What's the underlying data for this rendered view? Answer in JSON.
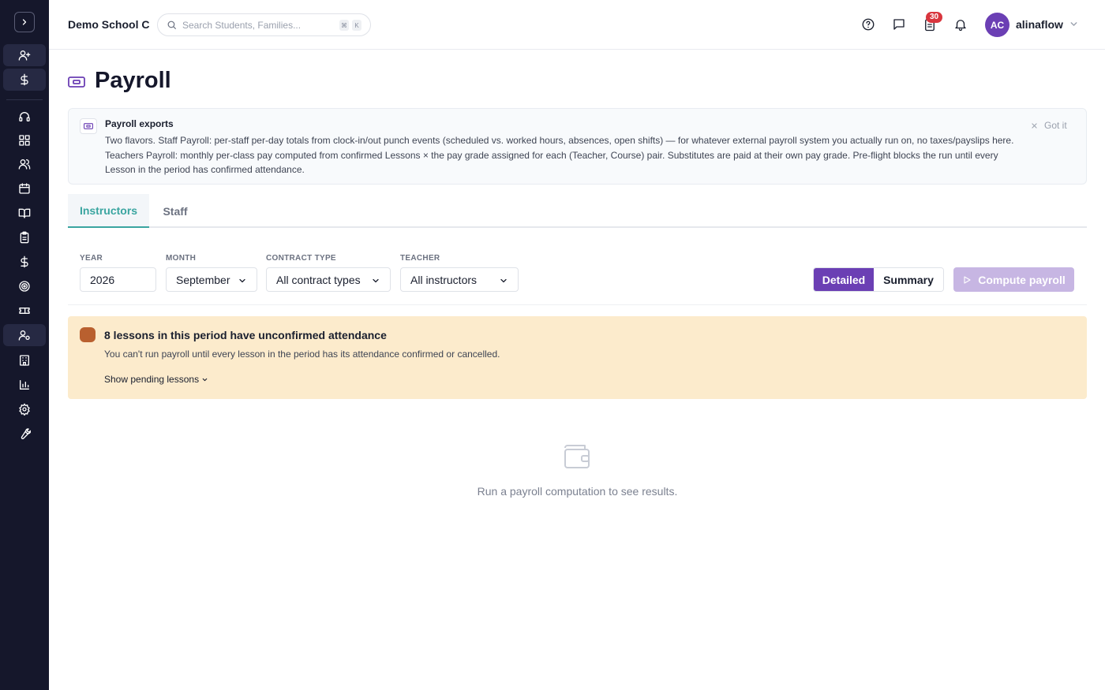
{
  "header": {
    "school_name": "Demo School C",
    "search_placeholder": "Search Students, Families...",
    "kbd_cmd": "⌘",
    "kbd_key": "K",
    "notification_count": "30",
    "avatar_initials": "AC",
    "username": "alinaflow"
  },
  "sidebar": {
    "items": [
      "add-user",
      "billing",
      "support",
      "dashboard",
      "people",
      "calendar",
      "courses",
      "tasks",
      "payments",
      "goals",
      "tickets",
      "payroll",
      "buildings",
      "reports",
      "settings",
      "tools"
    ],
    "active": "payroll"
  },
  "page": {
    "title": "Payroll"
  },
  "info": {
    "title": "Payroll exports",
    "body": "Two flavors. Staff Payroll: per-staff per-day totals from clock-in/out punch events (scheduled vs. worked hours, absences, open shifts) — for whatever external payroll system you actually run on, no taxes/payslips here. Teachers Payroll: monthly per-class pay computed from confirmed Lessons × the pay grade assigned for each (Teacher, Course) pair. Substitutes are paid at their own pay grade. Pre-flight blocks the run until every Lesson in the period has confirmed attendance.",
    "dismiss": "Got it"
  },
  "tabs": [
    {
      "label": "Instructors",
      "active": true
    },
    {
      "label": "Staff",
      "active": false
    }
  ],
  "filters": {
    "year_label": "YEAR",
    "year_value": "2026",
    "month_label": "MONTH",
    "month_value": "September",
    "contract_label": "CONTRACT TYPE",
    "contract_value": "All contract types",
    "teacher_label": "TEACHER",
    "teacher_value": "All instructors"
  },
  "view_toggle": {
    "detailed": "Detailed",
    "summary": "Summary",
    "selected": "Detailed"
  },
  "compute_button": "Compute payroll",
  "warning": {
    "title": "8 lessons in this period have unconfirmed attendance",
    "body": "You can't run payroll until every lesson in the period has its attendance confirmed or cancelled.",
    "link": "Show pending lessons"
  },
  "empty_state": "Run a payroll computation to see results.",
  "colors": {
    "sidebar_bg": "#15172b",
    "accent_purple": "#6b3fb4",
    "accent_teal": "#3aa5a0",
    "warning_bg": "#fcebcc",
    "badge_red": "#d9363e"
  }
}
